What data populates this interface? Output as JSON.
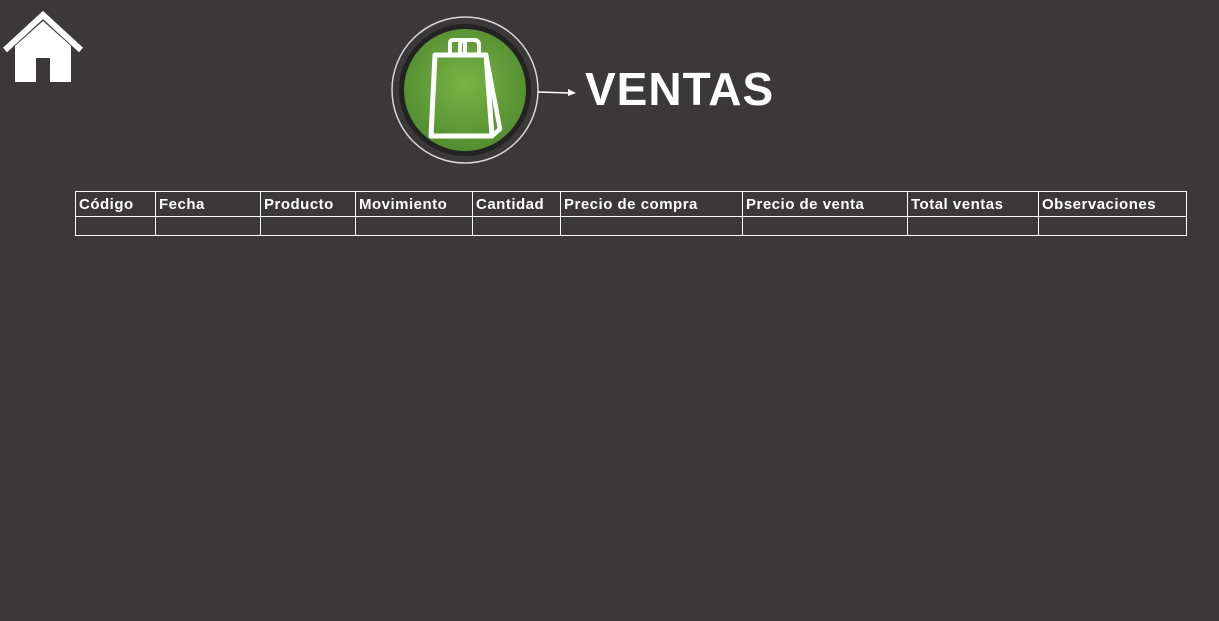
{
  "header": {
    "title": "VENTAS",
    "home_icon": "home-icon",
    "logo_icon": "shopping-bag-icon",
    "logo_color": "#5e9b3a"
  },
  "table": {
    "columns": [
      "Código",
      "Fecha",
      "Producto",
      "Movimiento",
      "Cantidad",
      "Precio de compra",
      "Precio de venta",
      "Total ventas",
      "Observaciones"
    ],
    "rows": [
      [
        "",
        "",
        "",
        "",
        "",
        "",
        "",
        "",
        ""
      ]
    ]
  }
}
